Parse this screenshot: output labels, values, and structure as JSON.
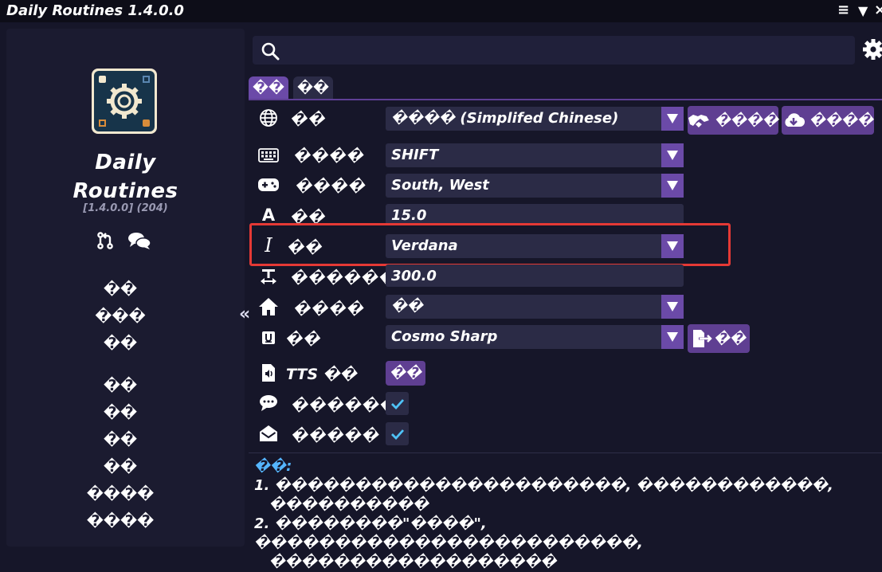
{
  "window": {
    "title": "Daily Routines 1.4.0.0",
    "controls": {
      "menu": "≡",
      "dropdown": "▼",
      "close": "×"
    }
  },
  "sidebar": {
    "app_name_line1": "Daily",
    "app_name_line2": "Routines",
    "version": "[1.4.0.0] (204)",
    "collapse": "«",
    "nav": [
      {
        "label": "��"
      },
      {
        "label": "���"
      },
      {
        "label": "��"
      },
      {
        "label": "��"
      },
      {
        "label": "��"
      },
      {
        "label": "��"
      },
      {
        "label": "��"
      },
      {
        "label": "����"
      },
      {
        "label": "����"
      }
    ]
  },
  "search": {
    "placeholder": ""
  },
  "tabs": [
    {
      "label": "��",
      "active": true
    },
    {
      "label": "��",
      "active": false
    }
  ],
  "settings": {
    "language": {
      "label": "��",
      "value": "���� (Simplifed Chinese)",
      "btn_translate": "����",
      "btn_download": "����"
    },
    "hotkey": {
      "label": "����",
      "value": "SHIFT"
    },
    "gamepad": {
      "label": "����",
      "value": "South, West"
    },
    "font_size": {
      "label": "��",
      "value": "15.0"
    },
    "font": {
      "label": "��",
      "value": "Verdana"
    },
    "width": {
      "label": "������",
      "value": "300.0"
    },
    "home": {
      "label": "����",
      "value": "��"
    },
    "ui_font": {
      "label": "��",
      "value": "Cosmo Sharp",
      "btn_export": "��"
    },
    "tts": {
      "label": "TTS ��",
      "btn": "��"
    },
    "chat": {
      "label": "������",
      "checked": true
    },
    "mail": {
      "label": "�����",
      "checked": true
    }
  },
  "notes": {
    "head": "��:",
    "lines": [
      "1. ����������������������, ������������,",
      "   ����������",
      "2. ��������\"����\", ������������������������,",
      "   ������������������"
    ]
  },
  "colors": {
    "background": "#161629",
    "panel": "#1b1b30",
    "control": "#2b2b46",
    "accent": "#6b4aa8",
    "highlight": "#e53935",
    "note_header": "#55b6ff",
    "check": "#4fc3f7"
  }
}
